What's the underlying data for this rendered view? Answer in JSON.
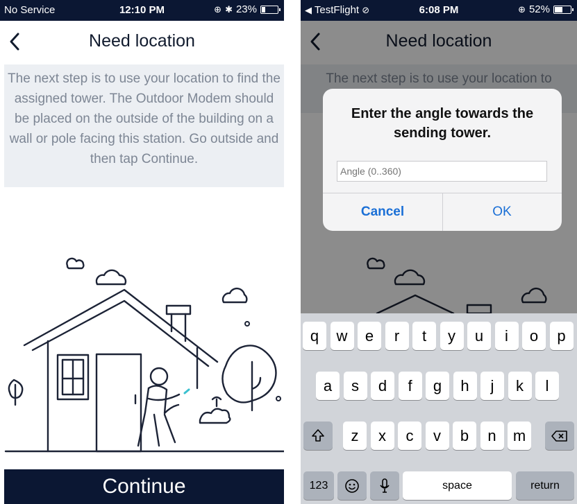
{
  "left_screen": {
    "status": {
      "carrier": "No Service",
      "time": "12:10 PM",
      "battery": "23%",
      "battery_level": 0.23
    },
    "nav_title": "Need location",
    "info_text": "The next step is to use your location to find the assigned tower. The Outdoor Modem  should be placed on the outside of the building on a wall or pole facing this station. Go outside and then tap Continue.",
    "continue_label": "Continue"
  },
  "right_screen": {
    "status": {
      "carrier": "TestFlight",
      "time": "6:08 PM",
      "battery": "52%",
      "battery_level": 0.52
    },
    "nav_title": "Need location",
    "bg_text_line": "The next step is to use your location to",
    "dialog": {
      "title": "Enter the angle towards the sending tower.",
      "placeholder": "Angle (0..360)",
      "cancel": "Cancel",
      "ok": "OK"
    },
    "keyboard": {
      "row1": [
        "q",
        "w",
        "e",
        "r",
        "t",
        "y",
        "u",
        "i",
        "o",
        "p"
      ],
      "row2": [
        "a",
        "s",
        "d",
        "f",
        "g",
        "h",
        "j",
        "k",
        "l"
      ],
      "row3": [
        "z",
        "x",
        "c",
        "v",
        "b",
        "n",
        "m"
      ],
      "numbers_key": "123",
      "space_key": "space",
      "return_key": "return"
    }
  },
  "colors": {
    "navy": "#0b1733",
    "info_bg": "#eceff3",
    "info_text": "#7d8694",
    "ios_blue": "#1a6fd6",
    "keyboard_bg": "#d1d4d9"
  }
}
